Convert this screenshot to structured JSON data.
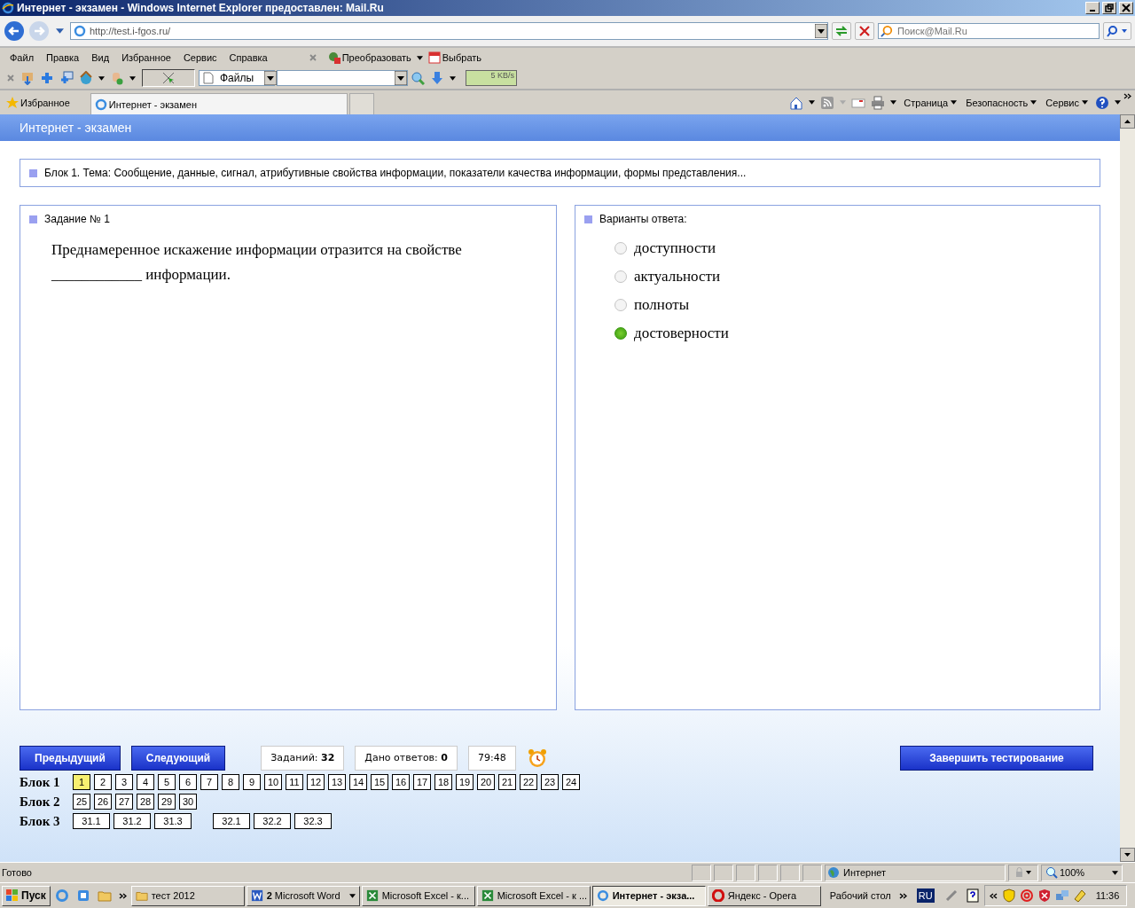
{
  "window": {
    "title": "Интернет - экзамен - Windows Internet Explorer предоставлен: Mail.Ru"
  },
  "address": {
    "url": "http://test.i-fgos.ru/",
    "search_placeholder": "Поиск@Mail.Ru"
  },
  "menu": [
    "Файл",
    "Правка",
    "Вид",
    "Избранное",
    "Сервис",
    "Справка"
  ],
  "addon": {
    "convert": "Преобразовать",
    "select": "Выбрать"
  },
  "toolbar": {
    "files": "Файлы",
    "speed": "5 KB/s"
  },
  "favorites_bar": {
    "favorites": "Избранное",
    "tab": "Интернет - экзамен"
  },
  "command_bar": [
    "Страница",
    "Безопасность",
    "Сервис"
  ],
  "page": {
    "header": "Интернет - экзамен",
    "topic": "Блок 1. Тема: Сообщение, данные, сигнал, атрибутивные свойства информации, показатели качества информации, формы представления...",
    "task": {
      "heading": "Задание № 1",
      "question": "Преднамеренное искажение информации отразится на свойстве ____________ информации."
    },
    "answers": {
      "heading": "Варианты ответа:",
      "options": [
        {
          "label": "доступности",
          "selected": false
        },
        {
          "label": "актуальности",
          "selected": false
        },
        {
          "label": "полноты",
          "selected": false
        },
        {
          "label": "достоверности",
          "selected": true
        }
      ]
    },
    "nav": {
      "prev": "Предыдущий",
      "next": "Следующий",
      "tasks": "Заданий: **32**",
      "answered": "Дано ответов: **0**",
      "timer": "79:48",
      "finish": "Завершить тестирование"
    },
    "blocks": [
      {
        "label": "Блок 1",
        "groups": [
          [
            {
              "label": "1",
              "selected": true
            },
            {
              "label": "2",
              "selected": false
            },
            {
              "label": "3",
              "selected": false
            },
            {
              "label": "4",
              "selected": false
            },
            {
              "label": "5",
              "selected": false
            },
            {
              "label": "6",
              "selected": false
            },
            {
              "label": "7",
              "selected": false
            },
            {
              "label": "8",
              "selected": false
            },
            {
              "label": "9",
              "selected": false
            },
            {
              "label": "10",
              "selected": false
            },
            {
              "label": "11",
              "selected": false
            },
            {
              "label": "12",
              "selected": false
            },
            {
              "label": "13",
              "selected": false
            },
            {
              "label": "14",
              "selected": false
            },
            {
              "label": "15",
              "selected": false
            },
            {
              "label": "16",
              "selected": false
            },
            {
              "label": "17",
              "selected": false
            },
            {
              "label": "18",
              "selected": false
            },
            {
              "label": "19",
              "selected": false
            },
            {
              "label": "20",
              "selected": false
            },
            {
              "label": "21",
              "selected": false
            },
            {
              "label": "22",
              "selected": false
            },
            {
              "label": "23",
              "selected": false
            },
            {
              "label": "24",
              "selected": false
            }
          ]
        ]
      },
      {
        "label": "Блок 2",
        "groups": [
          [
            {
              "label": "25",
              "selected": false
            },
            {
              "label": "26",
              "selected": false
            },
            {
              "label": "27",
              "selected": false
            },
            {
              "label": "28",
              "selected": false
            },
            {
              "label": "29",
              "selected": false
            },
            {
              "label": "30",
              "selected": false
            }
          ]
        ]
      },
      {
        "label": "Блок 3",
        "groups": [
          [
            {
              "label": "31.1",
              "selected": false
            },
            {
              "label": "31.2",
              "selected": false
            },
            {
              "label": "31.3",
              "selected": false
            }
          ],
          [
            {
              "label": "32.1",
              "selected": false
            },
            {
              "label": "32.2",
              "selected": false
            },
            {
              "label": "32.3",
              "selected": false
            }
          ]
        ]
      }
    ]
  },
  "status_bar": {
    "text": "Готово",
    "zone": "Интернет",
    "zoom": "100%"
  },
  "taskbar": {
    "start": "Пуск",
    "tasks": [
      {
        "label": "тест 2012",
        "kind": "folder",
        "selected": false
      },
      {
        "label": "**2** Microsoft Word",
        "kind": "word",
        "selected": false
      },
      {
        "label": "Microsoft Excel - к...",
        "kind": "excel",
        "selected": false
      },
      {
        "label": "Microsoft Excel - к ...",
        "kind": "excel",
        "selected": false
      },
      {
        "label": "Интернет - экза...",
        "kind": "ie",
        "selected": true
      },
      {
        "label": "Яндекс - Opera",
        "kind": "opera",
        "selected": false
      }
    ],
    "desktop": "Рабочий стол",
    "language": "RU",
    "clock": "11:36"
  }
}
